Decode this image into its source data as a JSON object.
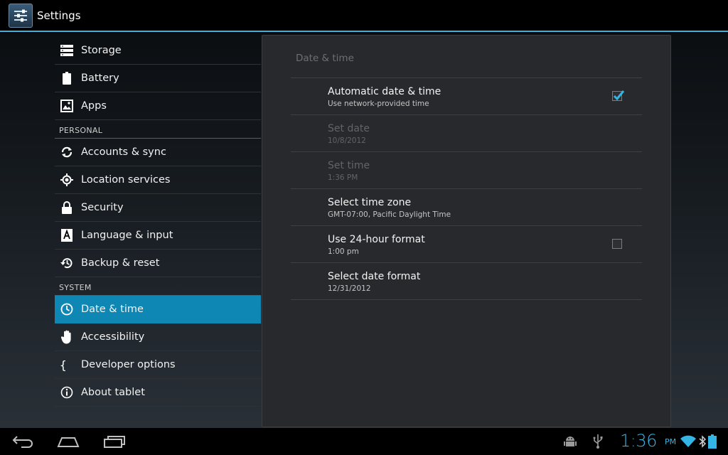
{
  "app": {
    "title": "Settings",
    "icon": "settings-sliders-icon"
  },
  "sidebar": {
    "items": [
      {
        "type": "item",
        "label": "Storage",
        "icon": "storage-icon"
      },
      {
        "type": "item",
        "label": "Battery",
        "icon": "battery-icon"
      },
      {
        "type": "item",
        "label": "Apps",
        "icon": "apps-icon"
      },
      {
        "type": "header",
        "label": "PERSONAL"
      },
      {
        "type": "item",
        "label": "Accounts & sync",
        "icon": "sync-icon"
      },
      {
        "type": "item",
        "label": "Location services",
        "icon": "location-icon"
      },
      {
        "type": "item",
        "label": "Security",
        "icon": "lock-icon"
      },
      {
        "type": "item",
        "label": "Language & input",
        "icon": "language-icon"
      },
      {
        "type": "item",
        "label": "Backup & reset",
        "icon": "backup-icon"
      },
      {
        "type": "header",
        "label": "SYSTEM"
      },
      {
        "type": "item",
        "label": "Date & time",
        "icon": "clock-icon",
        "active": true
      },
      {
        "type": "item",
        "label": "Accessibility",
        "icon": "hand-icon"
      },
      {
        "type": "item",
        "label": "Developer options",
        "icon": "braces-icon"
      },
      {
        "type": "item",
        "label": "About tablet",
        "icon": "info-icon"
      }
    ]
  },
  "panel": {
    "title": "Date & time",
    "prefs": [
      {
        "title": "Automatic date & time",
        "summary": "Use network-provided time",
        "checkbox": true,
        "checked": true,
        "enabled": true
      },
      {
        "title": "Set date",
        "summary": "10/8/2012",
        "checkbox": false,
        "enabled": false
      },
      {
        "title": "Set time",
        "summary": "1:36 PM",
        "checkbox": false,
        "enabled": false
      },
      {
        "title": "Select time zone",
        "summary": "GMT-07:00, Pacific Daylight Time",
        "checkbox": false,
        "enabled": true
      },
      {
        "title": "Use 24-hour format",
        "summary": "1:00 pm",
        "checkbox": true,
        "checked": false,
        "enabled": true
      },
      {
        "title": "Select date format",
        "summary": "12/31/2012",
        "checkbox": false,
        "enabled": true
      }
    ]
  },
  "statusbar": {
    "time": "1:36",
    "ampm": "PM",
    "icons": [
      "android-debug-icon",
      "usb-icon",
      "wifi-icon",
      "bluetooth-icon",
      "battery-status-icon"
    ]
  },
  "navbar": {
    "buttons": [
      "back-button",
      "home-button",
      "recent-apps-button"
    ]
  },
  "colors": {
    "accent": "#33b5e5",
    "active_item": "#0e87b5",
    "panel_bg": "#27292c"
  }
}
